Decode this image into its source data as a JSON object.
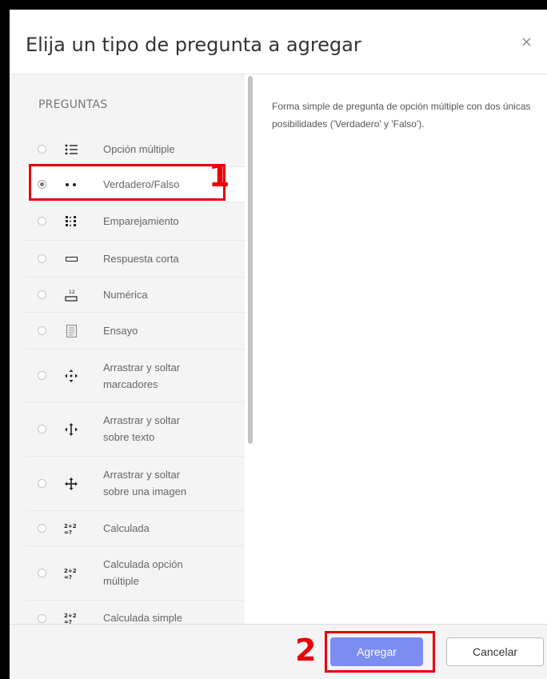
{
  "dialog": {
    "title": "Elija un tipo de pregunta a agregar",
    "close_glyph": "×"
  },
  "section_label": "PREGUNTAS",
  "options": [
    {
      "label_lines": [
        "Opción múltiple"
      ],
      "icon": "multichoice-icon",
      "selected": false
    },
    {
      "label_lines": [
        "Verdadero/Falso"
      ],
      "icon": "true-false-icon",
      "selected": true
    },
    {
      "label_lines": [
        "Emparejamiento"
      ],
      "icon": "matching-icon",
      "selected": false
    },
    {
      "label_lines": [
        "Respuesta corta"
      ],
      "icon": "short-answer-icon",
      "selected": false
    },
    {
      "label_lines": [
        "Numérica"
      ],
      "icon": "numerical-icon",
      "selected": false
    },
    {
      "label_lines": [
        "Ensayo"
      ],
      "icon": "essay-icon",
      "selected": false
    },
    {
      "label_lines": [
        "Arrastrar y soltar",
        "marcadores"
      ],
      "icon": "drag-drop-markers-icon",
      "selected": false
    },
    {
      "label_lines": [
        "Arrastrar y soltar",
        "sobre texto"
      ],
      "icon": "drag-drop-text-icon",
      "selected": false
    },
    {
      "label_lines": [
        "Arrastrar y soltar",
        "sobre una imagen"
      ],
      "icon": "drag-drop-image-icon",
      "selected": false
    },
    {
      "label_lines": [
        "Calculada"
      ],
      "icon": "calculated-icon",
      "selected": false
    },
    {
      "label_lines": [
        "Calculada opción",
        "múltiple"
      ],
      "icon": "calculated-multichoice-icon",
      "selected": false
    },
    {
      "label_lines": [
        "Calculada simple"
      ],
      "icon": "calculated-simple-icon",
      "selected": false
    }
  ],
  "description": "Forma simple de pregunta de opción múltiple con dos únicas posibilidades ('Verdadero' y 'Falso').",
  "footer": {
    "add_label": "Agregar",
    "cancel_label": "Cancelar"
  },
  "annotations": {
    "step1": "1",
    "step2": "2",
    "color": "#e8000b"
  },
  "colors": {
    "primary_button": "#7c8df0",
    "pane_background": "#f4f4f4"
  }
}
